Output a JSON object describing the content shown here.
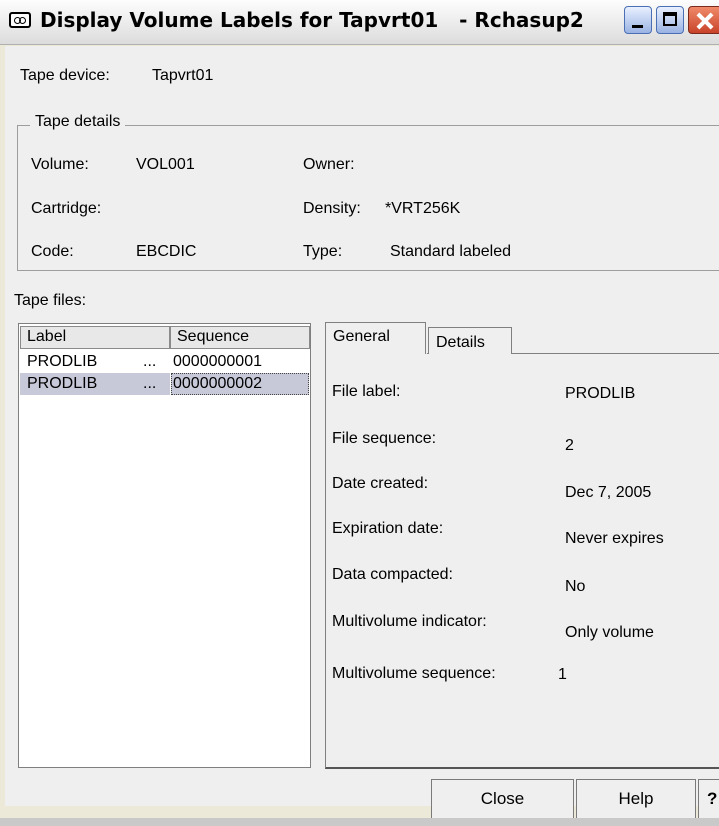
{
  "window": {
    "title": "Display Volume Labels for Tapvrt01   - Rchasup2",
    "icon": "tape-icon"
  },
  "tape_device": {
    "label": "Tape device:",
    "value": "Tapvrt01"
  },
  "tape_details": {
    "title": "Tape details",
    "volume_label": "Volume:",
    "volume_value": "VOL001",
    "owner_label": "Owner:",
    "owner_value": "",
    "cartridge_label": "Cartridge:",
    "cartridge_value": "",
    "density_label": "Density:",
    "density_value": "*VRT256K",
    "code_label": "Code:",
    "code_value": "EBCDIC",
    "type_label": "Type:",
    "type_value": "Standard labeled"
  },
  "tape_files": {
    "label": "Tape files:",
    "columns": [
      "Label",
      "Sequence"
    ],
    "rows": [
      {
        "label": "PRODLIB",
        "ellipsis": "...",
        "sequence": "0000000001",
        "selected": false
      },
      {
        "label": "PRODLIB",
        "ellipsis": "...",
        "sequence": "0000000002",
        "selected": true
      }
    ]
  },
  "tabs": [
    {
      "label": "General",
      "active": true
    },
    {
      "label": "Details",
      "active": false
    }
  ],
  "general": {
    "file_label_l": "File label:",
    "file_label_v": "PRODLIB",
    "file_sequence_l": "File sequence:",
    "file_sequence_v": "2",
    "date_created_l": "Date created:",
    "date_created_v": "Dec 7, 2005",
    "expiration_l": "Expiration date:",
    "expiration_v": "Never expires",
    "compacted_l": "Data compacted:",
    "compacted_v": "No",
    "multivol_ind_l": "Multivolume indicator:",
    "multivol_ind_v": "Only volume",
    "multivol_seq_l": "Multivolume sequence:",
    "multivol_seq_v": "1"
  },
  "buttons": {
    "close": "Close",
    "help": "Help",
    "whats_this": "?"
  },
  "colors": {
    "selection": "#c7c8d8",
    "dialog_bg": "#efefef"
  }
}
